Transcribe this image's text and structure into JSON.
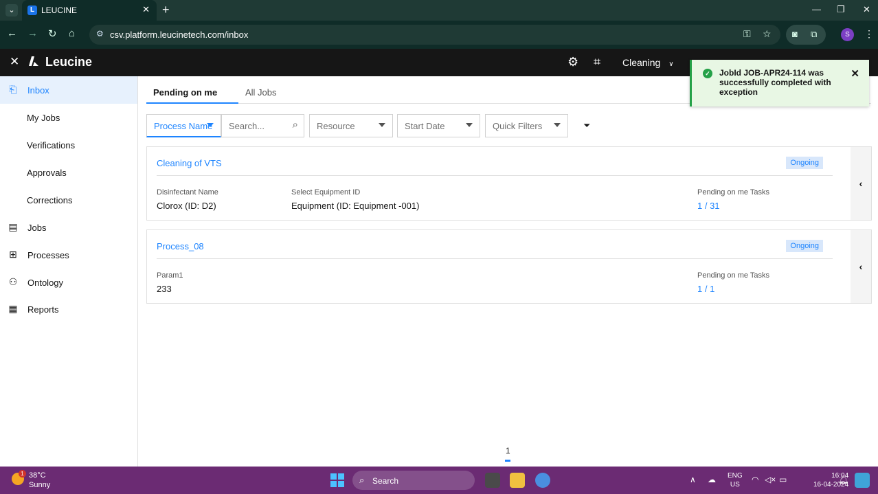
{
  "browser": {
    "tab_title": "LEUCINE",
    "url": "csv.platform.leucinetech.com/inbox"
  },
  "header": {
    "brand": "Leucine",
    "facility": "Cleaning"
  },
  "sidebar": {
    "items": [
      {
        "label": "Inbox",
        "icon": "inbox-icon"
      },
      {
        "label": "My Jobs"
      },
      {
        "label": "Verifications"
      },
      {
        "label": "Approvals"
      },
      {
        "label": "Corrections"
      },
      {
        "label": "Jobs",
        "icon": "clipboard-icon"
      },
      {
        "label": "Processes",
        "icon": "process-icon"
      },
      {
        "label": "Ontology",
        "icon": "hierarchy-icon"
      },
      {
        "label": "Reports",
        "icon": "report-icon"
      }
    ]
  },
  "tabs": [
    {
      "label": "Pending on me"
    },
    {
      "label": "All Jobs"
    }
  ],
  "filters": {
    "process_name": "Process Name",
    "search_placeholder": "Search...",
    "resource": "Resource",
    "start_date": "Start Date",
    "quick_filters": "Quick Filters"
  },
  "jobs": [
    {
      "name": "Cleaning of VTS",
      "status": "Ongoing",
      "params": [
        {
          "label": "Disinfectant Name",
          "value": "Clorox (ID: D2)"
        },
        {
          "label": "Select Equipment ID",
          "value": "Equipment (ID: Equipment -001)"
        }
      ],
      "pending_label": "Pending on me Tasks",
      "pending_value": "1 / 31"
    },
    {
      "name": "Process_08",
      "status": "Ongoing",
      "params": [
        {
          "label": "Param1",
          "value": "233"
        }
      ],
      "pending_label": "Pending on me Tasks",
      "pending_value": "1 / 1"
    }
  ],
  "pagination": {
    "current": "1"
  },
  "toast": {
    "message": "JobId JOB-APR24-114 was successfully completed with exception"
  },
  "taskbar": {
    "temperature": "38°C",
    "condition": "Sunny",
    "weather_badge": "1",
    "search": "Search",
    "lang_line1": "ENG",
    "lang_line2": "US",
    "time": "16:04",
    "date": "16-04-2024"
  },
  "colors": {
    "accent": "#1d84ff",
    "header_bg": "#161616",
    "success": "#24a148",
    "taskbar": "#6b2b73"
  }
}
